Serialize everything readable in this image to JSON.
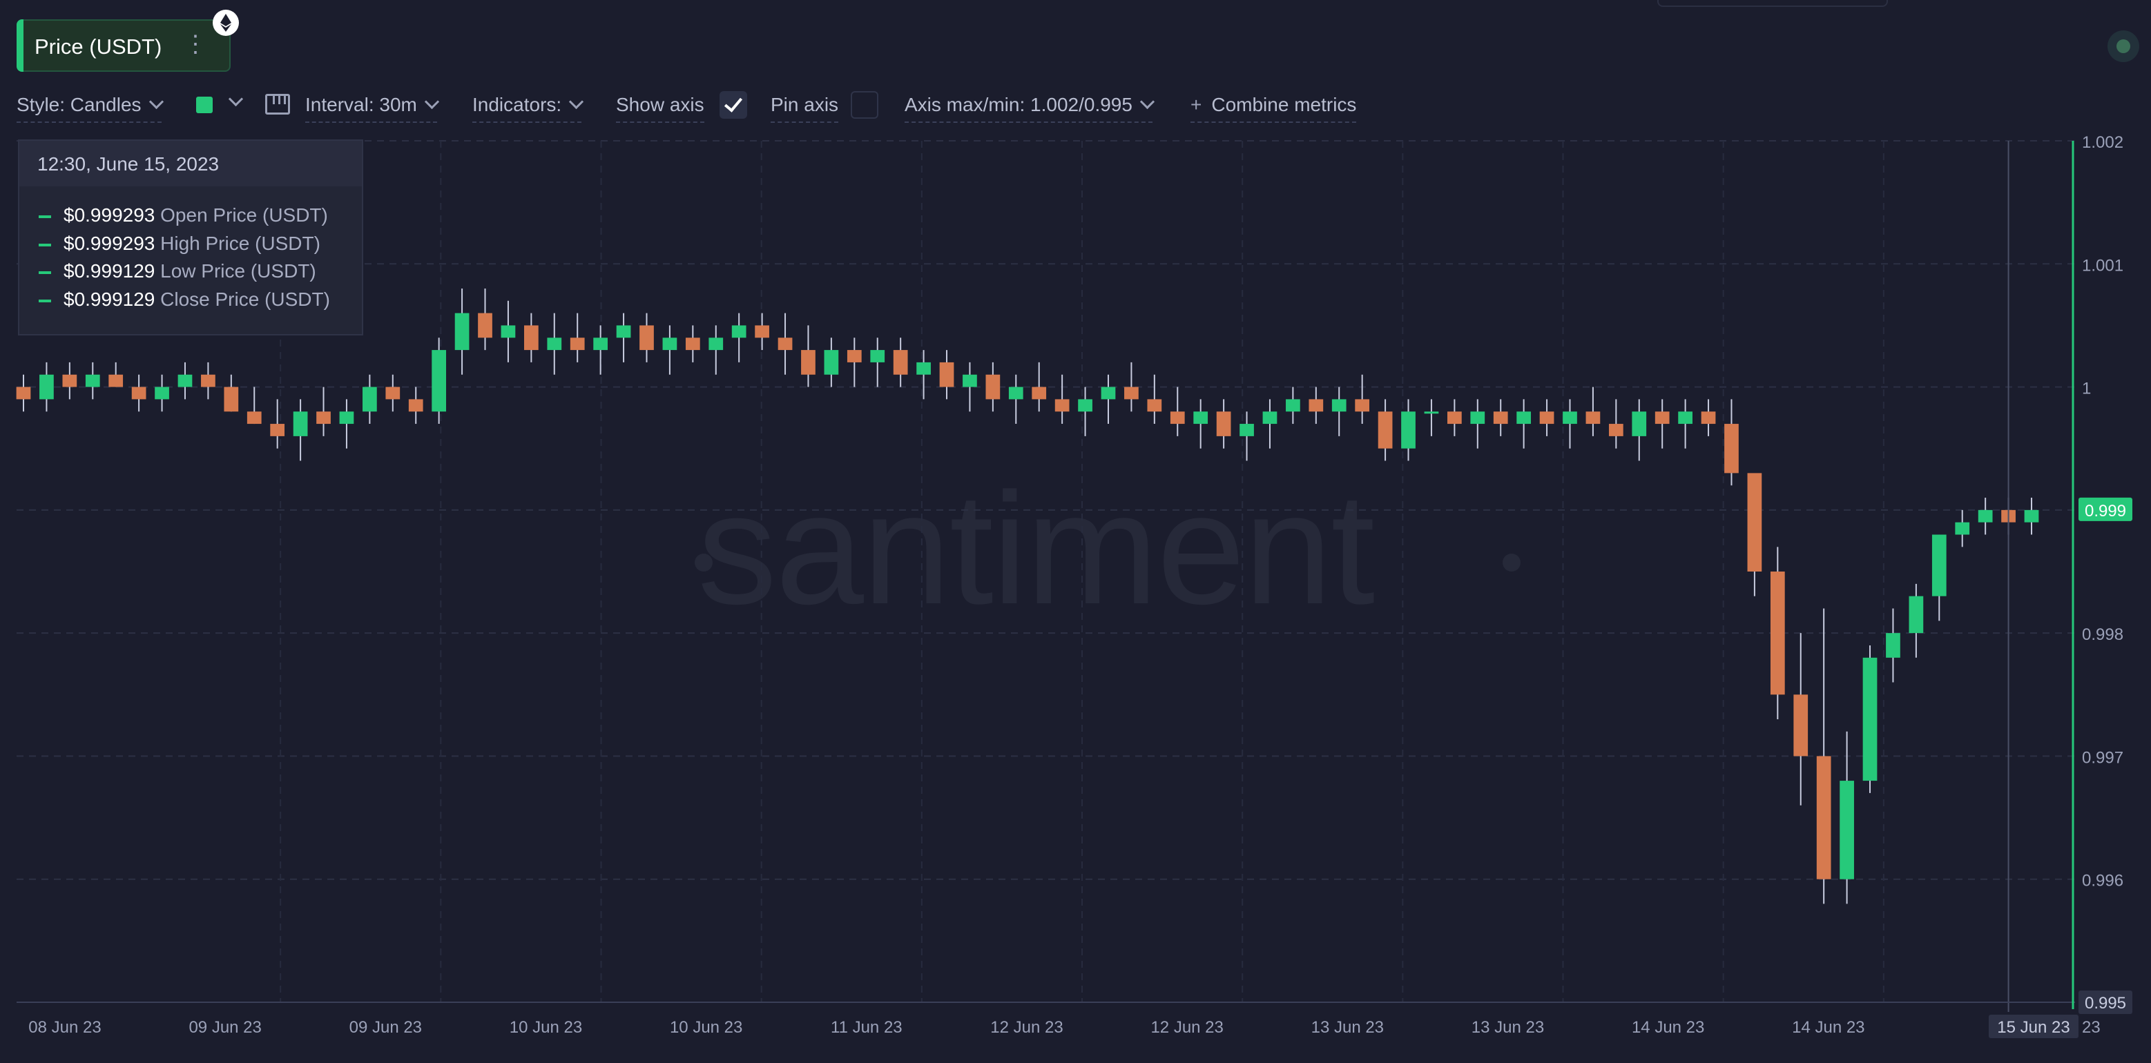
{
  "metric": {
    "label": "Price (USDT)",
    "menu_icon": "vertical-dots-icon",
    "badge_icon": "ethereum-icon"
  },
  "toolbar": {
    "style": "Style: Candles",
    "color": "#26c97a",
    "interval": "Interval: 30m",
    "indicators": "Indicators:",
    "show_axis": "Show axis",
    "show_axis_checked": true,
    "pin_axis": "Pin axis",
    "pin_axis_checked": false,
    "axis_maxmin": "Axis max/min: 1.002/0.995",
    "combine": "Combine metrics"
  },
  "tooltip": {
    "date": "12:30, June 15, 2023",
    "rows": [
      {
        "value": "$0.999293",
        "name": "Open Price (USDT)"
      },
      {
        "value": "$0.999293",
        "name": "High Price (USDT)"
      },
      {
        "value": "$0.999129",
        "name": "Low Price (USDT)"
      },
      {
        "value": "$0.999129",
        "name": "Close Price (USDT)"
      }
    ]
  },
  "watermark": "santiment",
  "colors": {
    "up": "#26c97a",
    "down": "#d67a4f",
    "background": "#1b1d2d",
    "accent": "#26c97a"
  },
  "chart_data": {
    "type": "candlestick",
    "interval": "30m",
    "ylim": [
      0.995,
      1.002
    ],
    "y_ticks": [
      "1.002",
      "1.001",
      "1",
      "0.999",
      "0.998",
      "0.997",
      "0.996",
      "0.995"
    ],
    "current_label": "0.999",
    "min_label": "0.995",
    "x_ticks": [
      "08 Jun 23",
      "09 Jun 23",
      "09 Jun 23",
      "10 Jun 23",
      "10 Jun 23",
      "11 Jun 23",
      "12 Jun 23",
      "12 Jun 23",
      "13 Jun 23",
      "13 Jun 23",
      "14 Jun 23",
      "14 Jun 23",
      "15 Jun 23"
    ],
    "x_tail": "23",
    "hover_label": "15 Jun 23",
    "grid": true,
    "candles_ohlc": [
      [
        1.0,
        1.0001,
        0.9998,
        0.9999
      ],
      [
        0.9999,
        1.0002,
        0.9998,
        1.0001
      ],
      [
        1.0001,
        1.0002,
        0.9999,
        1.0
      ],
      [
        1.0,
        1.0002,
        0.9999,
        1.0001
      ],
      [
        1.0001,
        1.0002,
        1.0,
        1.0
      ],
      [
        1.0,
        1.0001,
        0.9998,
        0.9999
      ],
      [
        0.9999,
        1.0001,
        0.9998,
        1.0
      ],
      [
        1.0,
        1.0002,
        0.9999,
        1.0001
      ],
      [
        1.0001,
        1.0002,
        0.9999,
        1.0
      ],
      [
        1.0,
        1.0001,
        0.9998,
        0.9998
      ],
      [
        0.9998,
        1.0,
        0.9997,
        0.9997
      ],
      [
        0.9997,
        0.9999,
        0.9995,
        0.9996
      ],
      [
        0.9996,
        0.9999,
        0.9994,
        0.9998
      ],
      [
        0.9998,
        1.0,
        0.9996,
        0.9997
      ],
      [
        0.9997,
        0.9999,
        0.9995,
        0.9998
      ],
      [
        0.9998,
        1.0001,
        0.9997,
        1.0
      ],
      [
        1.0,
        1.0001,
        0.9998,
        0.9999
      ],
      [
        0.9999,
        1.0,
        0.9997,
        0.9998
      ],
      [
        0.9998,
        1.0004,
        0.9997,
        1.0003
      ],
      [
        1.0003,
        1.0008,
        1.0001,
        1.0006
      ],
      [
        1.0006,
        1.0008,
        1.0003,
        1.0004
      ],
      [
        1.0004,
        1.0007,
        1.0002,
        1.0005
      ],
      [
        1.0005,
        1.0006,
        1.0002,
        1.0003
      ],
      [
        1.0003,
        1.0006,
        1.0001,
        1.0004
      ],
      [
        1.0004,
        1.0006,
        1.0002,
        1.0003
      ],
      [
        1.0003,
        1.0005,
        1.0001,
        1.0004
      ],
      [
        1.0004,
        1.0006,
        1.0002,
        1.0005
      ],
      [
        1.0005,
        1.0006,
        1.0002,
        1.0003
      ],
      [
        1.0003,
        1.0005,
        1.0001,
        1.0004
      ],
      [
        1.0004,
        1.0005,
        1.0002,
        1.0003
      ],
      [
        1.0003,
        1.0005,
        1.0001,
        1.0004
      ],
      [
        1.0004,
        1.0006,
        1.0002,
        1.0005
      ],
      [
        1.0005,
        1.0006,
        1.0003,
        1.0004
      ],
      [
        1.0004,
        1.0006,
        1.0001,
        1.0003
      ],
      [
        1.0003,
        1.0005,
        1.0,
        1.0001
      ],
      [
        1.0001,
        1.0004,
        1.0,
        1.0003
      ],
      [
        1.0003,
        1.0004,
        1.0,
        1.0002
      ],
      [
        1.0002,
        1.0004,
        1.0,
        1.0003
      ],
      [
        1.0003,
        1.0004,
        1.0,
        1.0001
      ],
      [
        1.0001,
        1.0003,
        0.9999,
        1.0002
      ],
      [
        1.0002,
        1.0003,
        0.9999,
        1.0
      ],
      [
        1.0,
        1.0002,
        0.9998,
        1.0001
      ],
      [
        1.0001,
        1.0002,
        0.9998,
        0.9999
      ],
      [
        0.9999,
        1.0001,
        0.9997,
        1.0
      ],
      [
        1.0,
        1.0002,
        0.9998,
        0.9999
      ],
      [
        0.9999,
        1.0001,
        0.9997,
        0.9998
      ],
      [
        0.9998,
        1.0,
        0.9996,
        0.9999
      ],
      [
        0.9999,
        1.0001,
        0.9997,
        1.0
      ],
      [
        1.0,
        1.0002,
        0.9998,
        0.9999
      ],
      [
        0.9999,
        1.0001,
        0.9997,
        0.9998
      ],
      [
        0.9998,
        1.0,
        0.9996,
        0.9997
      ],
      [
        0.9997,
        0.9999,
        0.9995,
        0.9998
      ],
      [
        0.9998,
        0.9999,
        0.9995,
        0.9996
      ],
      [
        0.9996,
        0.9998,
        0.9994,
        0.9997
      ],
      [
        0.9997,
        0.9999,
        0.9995,
        0.9998
      ],
      [
        0.9998,
        1.0,
        0.9997,
        0.9999
      ],
      [
        0.9999,
        1.0,
        0.9997,
        0.9998
      ],
      [
        0.9998,
        1.0,
        0.9996,
        0.9999
      ],
      [
        0.9999,
        1.0001,
        0.9997,
        0.9998
      ],
      [
        0.9998,
        0.9999,
        0.9994,
        0.9995
      ],
      [
        0.9995,
        0.9999,
        0.9994,
        0.9998
      ],
      [
        0.9998,
        0.9999,
        0.9996,
        0.9998
      ],
      [
        0.9998,
        0.9999,
        0.9996,
        0.9997
      ],
      [
        0.9997,
        0.9999,
        0.9995,
        0.9998
      ],
      [
        0.9998,
        0.9999,
        0.9996,
        0.9997
      ],
      [
        0.9997,
        0.9999,
        0.9995,
        0.9998
      ],
      [
        0.9998,
        0.9999,
        0.9996,
        0.9997
      ],
      [
        0.9997,
        0.9999,
        0.9995,
        0.9998
      ],
      [
        0.9998,
        1.0,
        0.9996,
        0.9997
      ],
      [
        0.9997,
        0.9999,
        0.9995,
        0.9996
      ],
      [
        0.9996,
        0.9999,
        0.9994,
        0.9998
      ],
      [
        0.9998,
        0.9999,
        0.9995,
        0.9997
      ],
      [
        0.9997,
        0.9999,
        0.9995,
        0.9998
      ],
      [
        0.9998,
        0.9999,
        0.9996,
        0.9997
      ],
      [
        0.9997,
        0.9999,
        0.9992,
        0.9993
      ],
      [
        0.9993,
        0.9986,
        0.9983,
        0.9985
      ],
      [
        0.9985,
        0.9987,
        0.9973,
        0.9975
      ],
      [
        0.9975,
        0.998,
        0.9966,
        0.997
      ],
      [
        0.997,
        0.9982,
        0.9958,
        0.996
      ],
      [
        0.996,
        0.9972,
        0.9958,
        0.9968
      ],
      [
        0.9968,
        0.9979,
        0.9967,
        0.9978
      ],
      [
        0.9978,
        0.9982,
        0.9976,
        0.998
      ],
      [
        0.998,
        0.9984,
        0.9978,
        0.9983
      ],
      [
        0.9983,
        0.9988,
        0.9981,
        0.9988
      ],
      [
        0.9988,
        0.999,
        0.9987,
        0.9989
      ],
      [
        0.9989,
        0.9991,
        0.9988,
        0.999
      ],
      [
        0.999,
        0.9991,
        0.9988,
        0.9989
      ],
      [
        0.9989,
        0.9991,
        0.9988,
        0.999
      ]
    ]
  }
}
